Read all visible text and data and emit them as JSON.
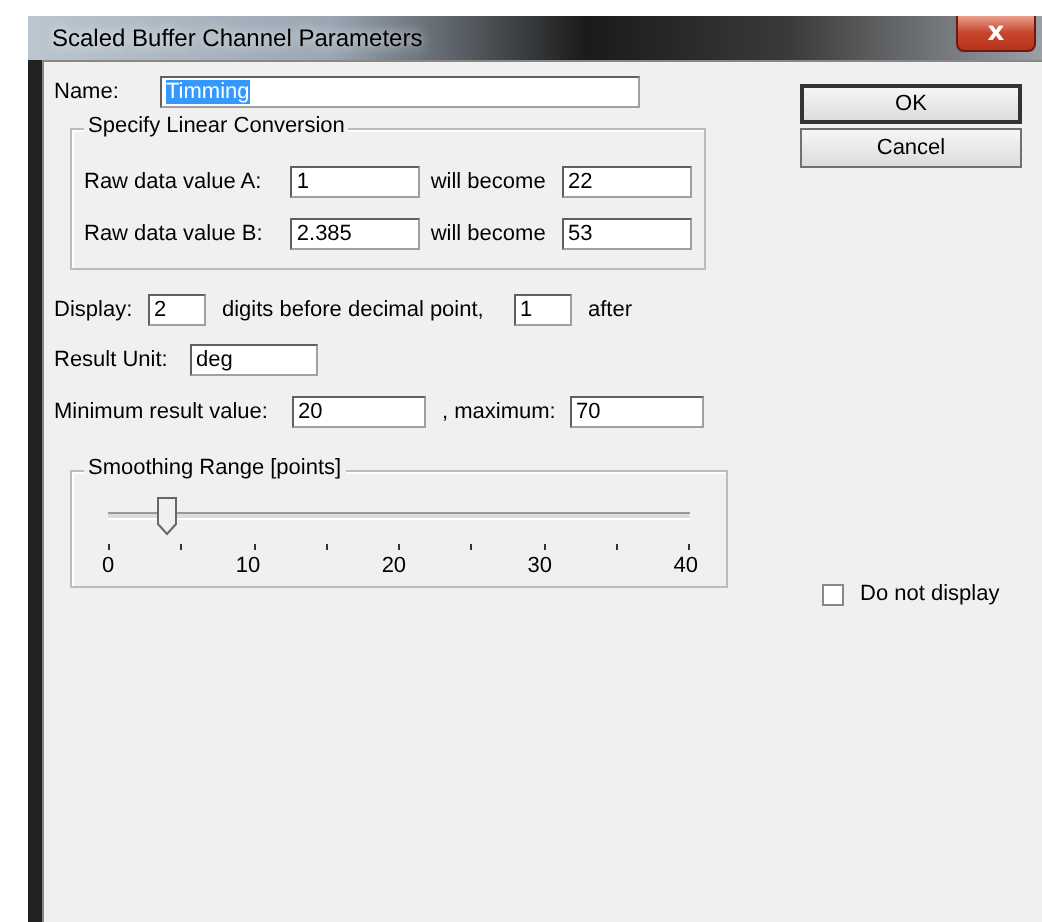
{
  "window": {
    "title": "Scaled Buffer Channel Parameters",
    "close": "x"
  },
  "name": {
    "label": "Name:",
    "value": "Timming",
    "selected": true
  },
  "conversion": {
    "title": "Specify Linear Conversion",
    "rows": [
      {
        "label": "Raw data value A:",
        "raw": "1",
        "becomes_label": "will become",
        "becomes": "22"
      },
      {
        "label": "Raw data value B:",
        "raw": "2.385",
        "becomes_label": "will become",
        "becomes": "53"
      }
    ]
  },
  "display": {
    "label": "Display:",
    "before": "2",
    "middle": "digits before decimal point,",
    "after": "1",
    "after_label": "after"
  },
  "unit": {
    "label": "Result Unit:",
    "value": "deg"
  },
  "range": {
    "min_label": "Minimum result value:",
    "min": "20",
    "max_label": ", maximum:",
    "max": "70"
  },
  "smoothing": {
    "title": "Smoothing Range [points]",
    "level": 0.1,
    "tick_labels": [
      "0",
      "10",
      "20",
      "30",
      "40"
    ]
  },
  "do_not_display": {
    "label": "Do not display",
    "checked": false
  },
  "buttons": [
    "OK",
    "Cancel"
  ]
}
